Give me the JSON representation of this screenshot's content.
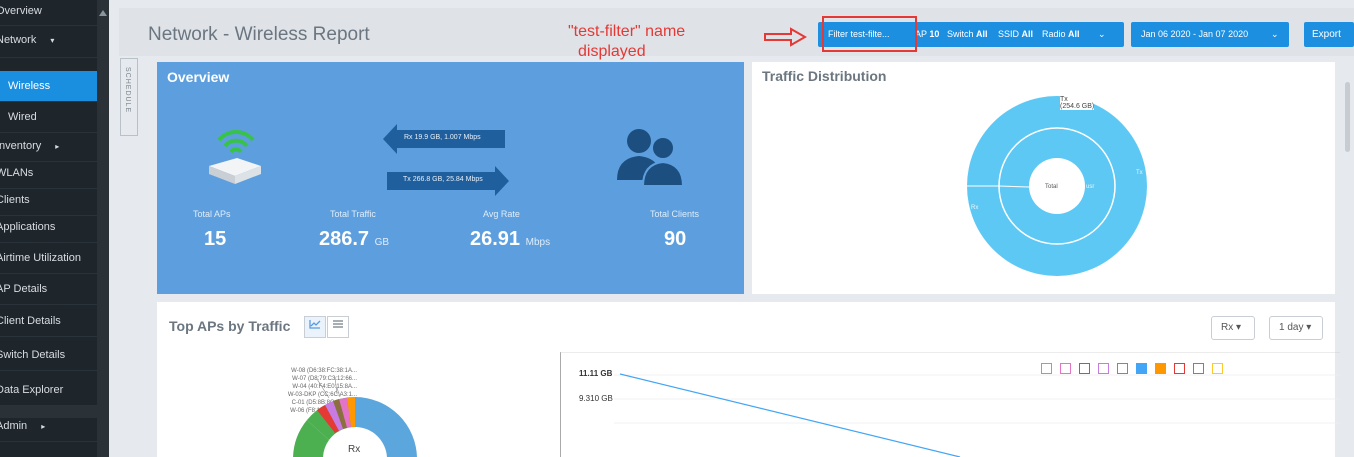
{
  "sidebar": {
    "items": [
      {
        "label": "Overview",
        "active": false,
        "sub": false,
        "caret": ""
      },
      {
        "label": "Network",
        "active": false,
        "sub": false,
        "caret": "▾"
      },
      {
        "label": "Wireless",
        "active": true,
        "sub": true,
        "caret": ""
      },
      {
        "label": "Wired",
        "active": false,
        "sub": true,
        "caret": ""
      },
      {
        "label": "Inventory",
        "active": false,
        "sub": false,
        "caret": "▸"
      },
      {
        "label": "WLANs",
        "active": false,
        "sub": false,
        "caret": ""
      },
      {
        "label": "Clients",
        "active": false,
        "sub": false,
        "caret": ""
      },
      {
        "label": "Applications",
        "active": false,
        "sub": false,
        "caret": ""
      },
      {
        "label": "Airtime Utilization",
        "active": false,
        "sub": false,
        "caret": ""
      },
      {
        "label": "AP Details",
        "active": false,
        "sub": false,
        "caret": ""
      },
      {
        "label": "Client Details",
        "active": false,
        "sub": false,
        "caret": ""
      },
      {
        "label": "Switch Details",
        "active": false,
        "sub": false,
        "caret": ""
      },
      {
        "label": "Data Explorer",
        "active": false,
        "sub": false,
        "caret": ""
      },
      {
        "label": "Admin",
        "active": false,
        "sub": false,
        "caret": "▸"
      }
    ]
  },
  "header": {
    "title": "Network - Wireless Report",
    "annotation_line1": "\"test-filter\" name",
    "annotation_line2": "displayed",
    "filter": {
      "filter_label": "Filter test-filte...",
      "ap_label": "AP",
      "ap_value": "10",
      "switch_label": "Switch",
      "switch_value": "All",
      "ssid_label": "SSID",
      "ssid_value": "All",
      "radio_label": "Radio",
      "radio_value": "All",
      "caret": "⌄"
    },
    "date_range": "Jan 06 2020 - Jan 07 2020",
    "date_caret": "⌄",
    "export_label": "Export"
  },
  "schedule_label": "SCHEDULE",
  "overview": {
    "title": "Overview",
    "rx_text": "Rx 19.9 GB, 1.007 Mbps",
    "tx_text": "Tx 266.8 GB, 25.84 Mbps",
    "stats": [
      {
        "label": "Total APs",
        "value": "15",
        "unit": ""
      },
      {
        "label": "Total Traffic",
        "value": "286.7",
        "unit": "GB"
      },
      {
        "label": "Avg Rate",
        "value": "26.91",
        "unit": "Mbps"
      },
      {
        "label": "Total Clients",
        "value": "90",
        "unit": ""
      }
    ],
    "colors": {
      "card": "#5d9fde",
      "arrow": "#1f5f9e",
      "icon": "#1c4f80"
    }
  },
  "traffic_distribution": {
    "title": "Traffic Distribution",
    "tooltip_line1": "Tx",
    "tooltip_line2": "(254.6 GB)",
    "center_label": "Total",
    "ring_labels": {
      "tx": "Tx",
      "rx": "Rx",
      "usr": "usr"
    },
    "colors": {
      "ring": "#5ec8f5"
    }
  },
  "top_aps": {
    "title": "Top APs by Traffic",
    "view_chart_icon": "line-chart-icon",
    "view_list_icon": "list-icon",
    "direction_select": "Rx",
    "period_select": "1 day",
    "donut_labels": [
      "W-08 (D6:38:FC:38:1A...",
      "W-07 (D8:79:C3:12:66...",
      "W-04 (40:F4:E0:15:8A...",
      "W-03-DKP (CC:6C:A3:1...",
      "C-01 (D5:8B:8C:0C:13...",
      "W-06 (F8:1E:BA:29:DK..."
    ],
    "donut_center": "Rx",
    "line_ticks": [
      "11.11 GB",
      "9.310 GB"
    ],
    "legend_colors": [
      "#9e9e9e",
      "#e573c7",
      "#8d6e3f",
      "#c77be3",
      "#4caf50",
      "#42a5f5",
      "#ff9800",
      "#e53935",
      "#26a6b0",
      "#ffca28"
    ]
  }
}
